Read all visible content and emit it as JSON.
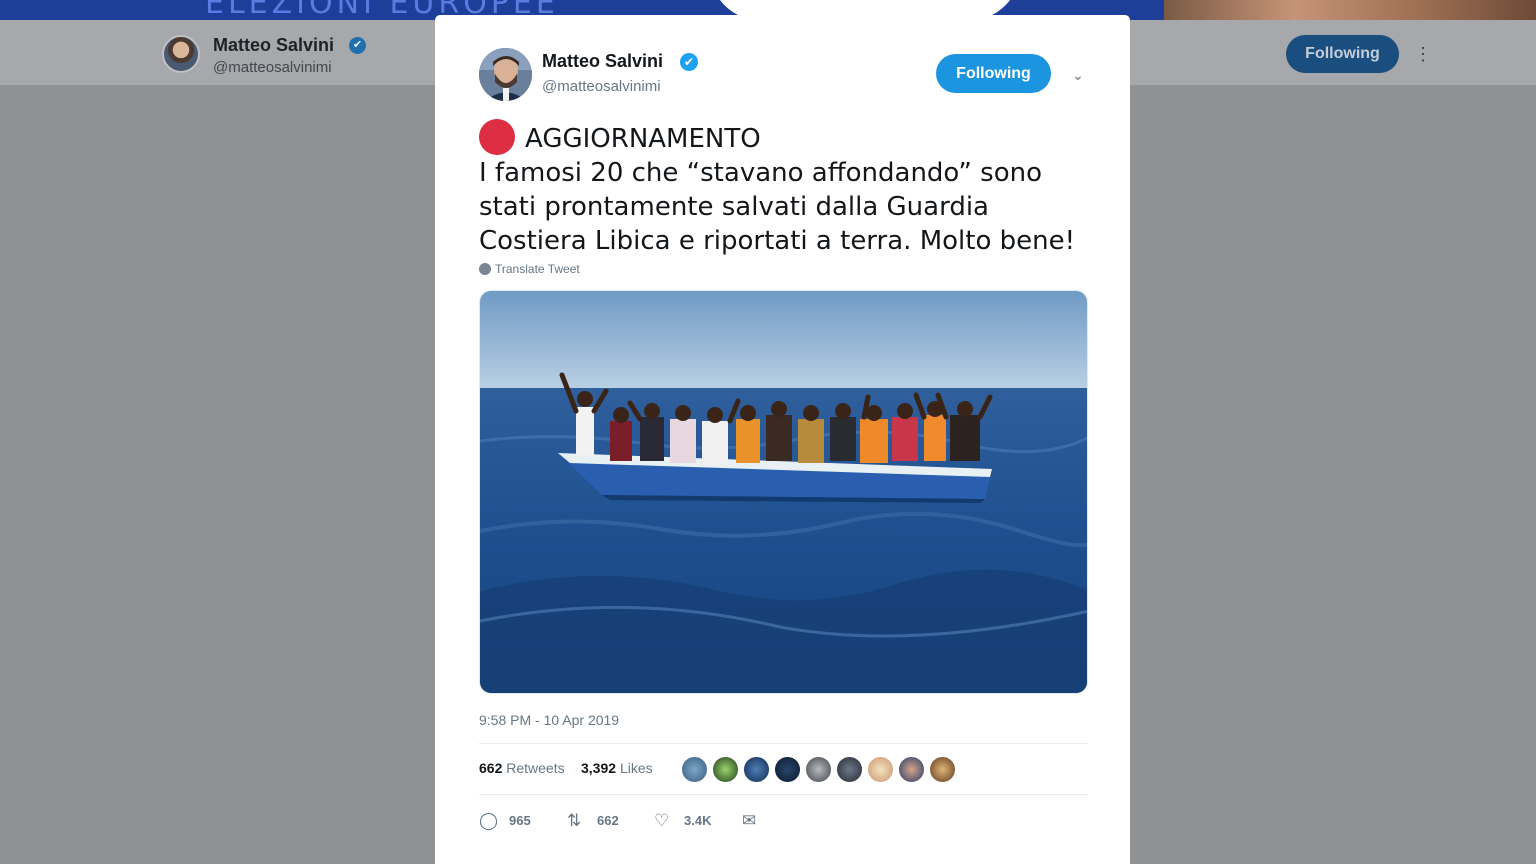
{
  "background_header": {
    "banner_text": "ELEZIONI EUROPEE",
    "name": "Matteo Salvini",
    "handle": "@matteosalvinimi",
    "follow_label": "Following"
  },
  "tweet": {
    "author_name": "Matteo Salvini",
    "author_handle": "@matteosalvinimi",
    "follow_label": "Following",
    "text_lines": [
      "AGGIORNAMENTO",
      "I famosi 20 che “stavano affondando” sono",
      "stati prontamente salvati dalla Guardia",
      "Costiera Libica e riportati a terra. Molto bene!"
    ],
    "translate_label": "Translate Tweet",
    "timestamp": "9:58 PM - 10 Apr 2019",
    "retweets_count": "662",
    "retweets_label": "Retweets",
    "likes_count": "3,392",
    "likes_label": "Likes",
    "actions": {
      "reply_count": "965",
      "retweet_count": "662",
      "like_count": "3.4K"
    }
  },
  "colors": {
    "accent": "#1da1f2",
    "follow_button": "#1b95e0",
    "red_circle": "#dd2e44",
    "overlay": "#8f9295"
  },
  "icons": [
    "verified-badge-icon",
    "chevron-down-icon",
    "red-circle-emoji",
    "globe-icon",
    "reply-icon",
    "retweet-icon",
    "like-icon",
    "message-icon",
    "more-dots-icon"
  ]
}
